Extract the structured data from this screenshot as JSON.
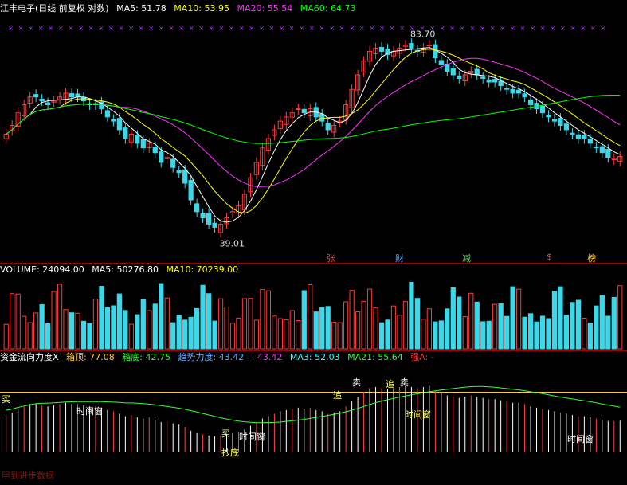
{
  "title": "江丰电子(日线 前复权 对数)",
  "price_legend": [
    {
      "label": "MA5: 51.78",
      "color": "#ffffff"
    },
    {
      "label": "MA10: 53.95",
      "color": "#ffff00"
    },
    {
      "label": "MA20: 55.54",
      "color": "#ff33ff"
    },
    {
      "label": "MA60: 64.73",
      "color": "#00ff00"
    }
  ],
  "volume_legend": [
    {
      "label": "VOLUME: 24094.00",
      "color": "#ffffff"
    },
    {
      "label": "MA5: 50276.80",
      "color": "#ffffff"
    },
    {
      "label": "MA10: 70239.00",
      "color": "#ffff00"
    }
  ],
  "indicator_legend": [
    {
      "label": "资金流向力度X",
      "color": "#ffffff"
    },
    {
      "label": "箱顶: 77.08",
      "color": "#ffcc33"
    },
    {
      "label": "箱底: 42.75",
      "color": "#33ff33"
    },
    {
      "label": "趋势力度: 43.42",
      "color": "#66aaff"
    },
    {
      "label": ": 43.42",
      "color": "#ff33ff"
    },
    {
      "label": "MA3: 52.03",
      "color": "#33ffff"
    },
    {
      "label": "MA21: 55.64",
      "color": "#33ff33"
    },
    {
      "label": "强A: -",
      "color": "#ff3333"
    }
  ],
  "events": [
    {
      "label": "张",
      "color": "#ff4444"
    },
    {
      "label": "财",
      "color": "#66aaff"
    },
    {
      "label": "减",
      "color": "#66cc66"
    },
    {
      "label": "$",
      "color": "#ff4444"
    },
    {
      "label": "榜",
      "color": "#ffcc00"
    }
  ],
  "signals": [
    "买",
    "时间窗",
    "买",
    "时间窗",
    "追",
    "卖",
    "追",
    "卖",
    "时间窗",
    "时间窗",
    "抄底"
  ],
  "watermark": "甲到进步数据",
  "chart_data": {
    "type": "candlestick",
    "title": "江丰电子(日线 前复权 对数)",
    "high_label": "83.70",
    "low_label": "39.01",
    "ma": {
      "MA5": 51.78,
      "MA10": 53.95,
      "MA20": 55.54,
      "MA60": 64.73
    },
    "price_range": [
      36,
      88
    ],
    "volume": {
      "last": 24094.0,
      "MA5": 50276.8,
      "MA10": 70239.0
    },
    "indicator": {
      "box_top": 77.08,
      "box_bottom": 42.75,
      "trend": 43.42,
      "MA3": 52.03,
      "MA21": 55.64
    },
    "closes": [
      57,
      59,
      62,
      64,
      66,
      66,
      65,
      64,
      65,
      66,
      67,
      66,
      66,
      65,
      64,
      64,
      63,
      61,
      60,
      58,
      56,
      57,
      55,
      54,
      55,
      53,
      51,
      52,
      50,
      49,
      47,
      44,
      42,
      41,
      40,
      39.5,
      40,
      41,
      42,
      43,
      45,
      48,
      51,
      54,
      56,
      58,
      60,
      61,
      62,
      63,
      62,
      63,
      61,
      60,
      58,
      59,
      60,
      64,
      68,
      72,
      76,
      79,
      80,
      79,
      78,
      79,
      80,
      81,
      80,
      79,
      80,
      81,
      77,
      75,
      73,
      72,
      71,
      72,
      73,
      72,
      71,
      70,
      70,
      69,
      68,
      67,
      67,
      66,
      64,
      63,
      62,
      61,
      60,
      59,
      58,
      57,
      56,
      56,
      55,
      54,
      53,
      52,
      51.8,
      52.2
    ]
  }
}
